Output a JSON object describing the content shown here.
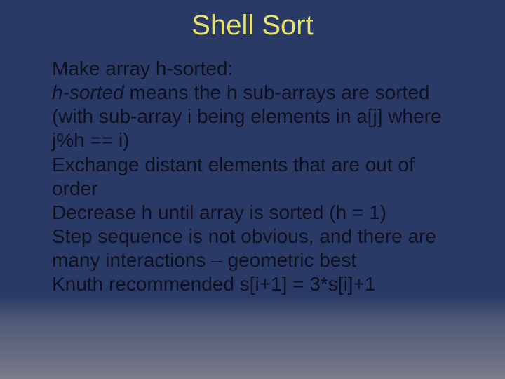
{
  "slide": {
    "title": "Shell Sort",
    "lines": {
      "l1": "Make array h-sorted:",
      "l2a": "h-sorted",
      "l2b": " means the h sub-arrays are sorted (with sub-array i being elements in a[j] where j%h == i)",
      "l3": "Exchange distant elements that are out of order",
      "l4": "Decrease h until array is sorted (h = 1)",
      "l5": "Step sequence is not obvious, and there are many interactions – geometric best",
      "l6": "Knuth recommended s[i+1] = 3*s[i]+1"
    }
  }
}
